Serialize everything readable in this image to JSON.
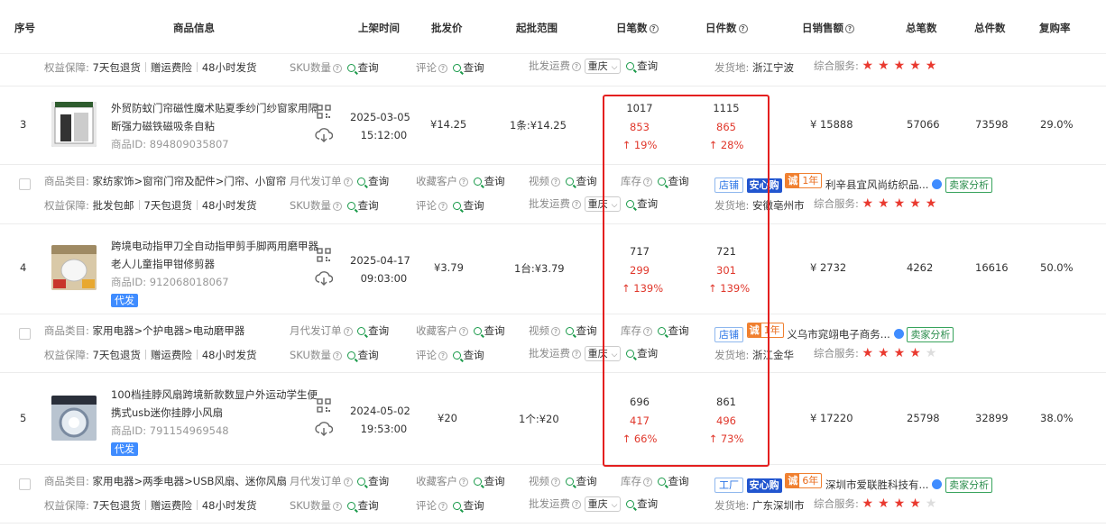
{
  "header": {
    "cols": [
      "序号",
      "商品信息",
      "上架时间",
      "批发价",
      "起批范围",
      "日笔数",
      "日件数",
      "日销售额",
      "总笔数",
      "总件数",
      "复购率"
    ]
  },
  "top_partial": {
    "guarantee_label": "权益保障:",
    "guarantee_tags": [
      "7天包退货",
      "赠运费险",
      "48小时发货"
    ],
    "sku_label": "SKU数量",
    "sku_link": "查询",
    "review_label": "评论",
    "review_link": "查询",
    "freight_label": "批发运费",
    "freight_select": "重庆",
    "freight_link": "查询",
    "ship_label": "发货地:",
    "ship_value": "浙江宁波",
    "service_label": "综合服务:",
    "stars": 5
  },
  "rows": [
    {
      "index": "3",
      "title_line1": "外贸防蚊门帘磁性魔术贴夏季纱门纱窗家用隔",
      "title_line2": "断强力磁铁磁吸条自粘",
      "product_id_label": "商品ID:",
      "product_id": "894809035807",
      "daifa": "",
      "listed_date": "2025-03-05",
      "listed_time": "15:12:00",
      "price": "¥14.25",
      "moq": "1条:¥14.25",
      "daily_orders": "1017",
      "daily_orders_prev": "853",
      "daily_orders_change": "↑ 19%",
      "daily_pieces": "1115",
      "daily_pieces_prev": "865",
      "daily_pieces_change": "↑ 28%",
      "daily_sales": "¥ 15888",
      "total_orders": "57066",
      "total_pieces": "73598",
      "repurchase": "29.0%",
      "category_label": "商品类目:",
      "category": "家纺家饰>窗帘门帘及配件>门帘、小窗帘",
      "monthly_label": "月代发订单",
      "monthly_link": "查询",
      "collect_label": "收藏客户",
      "collect_link": "查询",
      "video_label": "视频",
      "video_link": "查询",
      "stock_label": "库存",
      "stock_link": "查询",
      "shop_type": "店铺",
      "trust_badge": "安心购",
      "year_badge": "1年",
      "shop_name": "利辛县宜风尚纺织品...",
      "analysis": "卖家分析",
      "guarantee_label": "权益保障:",
      "guarantee_tags": [
        "批发包邮",
        "7天包退货",
        "48小时发货"
      ],
      "sku_label": "SKU数量",
      "sku_link": "查询",
      "review_label": "评论",
      "review_link": "查询",
      "freight_label": "批发运费",
      "freight_select": "重庆",
      "freight_link": "查询",
      "ship_label": "发货地:",
      "ship_value": "安徽亳州市",
      "service_label": "综合服务:",
      "stars": 5,
      "thumb_color": "#6d7a86"
    },
    {
      "index": "4",
      "title_line1": "跨境电动指甲刀全自动指甲剪手脚两用磨甲器",
      "title_line2": "老人儿童指甲钳修剪器",
      "product_id_label": "商品ID:",
      "product_id": "912068018067",
      "daifa": "代发",
      "listed_date": "2025-04-17",
      "listed_time": "09:03:00",
      "price": "¥3.79",
      "moq": "1台:¥3.79",
      "daily_orders": "717",
      "daily_orders_prev": "299",
      "daily_orders_change": "↑ 139%",
      "daily_pieces": "721",
      "daily_pieces_prev": "301",
      "daily_pieces_change": "↑ 139%",
      "daily_sales": "¥ 2732",
      "total_orders": "4262",
      "total_pieces": "16616",
      "repurchase": "50.0%",
      "category_label": "商品类目:",
      "category": "家用电器>个护电器>电动磨甲器",
      "monthly_label": "月代发订单",
      "monthly_link": "查询",
      "collect_label": "收藏客户",
      "collect_link": "查询",
      "video_label": "视频",
      "video_link": "查询",
      "stock_label": "库存",
      "stock_link": "查询",
      "shop_type": "店铺",
      "trust_badge": "",
      "year_badge": "1年",
      "shop_name": "义乌市窕翊电子商务...",
      "analysis": "卖家分析",
      "guarantee_label": "权益保障:",
      "guarantee_tags": [
        "7天包退货",
        "赠运费险",
        "48小时发货"
      ],
      "sku_label": "SKU数量",
      "sku_link": "查询",
      "review_label": "评论",
      "review_link": "查询",
      "freight_label": "批发运费",
      "freight_select": "重庆",
      "freight_link": "查询",
      "ship_label": "发货地:",
      "ship_value": "浙江金华",
      "service_label": "综合服务:",
      "stars": 4,
      "thumb_color": "#c9b89b"
    },
    {
      "index": "5",
      "title_line1": "100档挂脖风扇跨境新款数显户外运动学生便",
      "title_line2": "携式usb迷你挂脖小风扇",
      "product_id_label": "商品ID:",
      "product_id": "791154969548",
      "daifa": "代发",
      "listed_date": "2024-05-02",
      "listed_time": "19:53:00",
      "price": "¥20",
      "moq": "1个:¥20",
      "daily_orders": "696",
      "daily_orders_prev": "417",
      "daily_orders_change": "↑ 66%",
      "daily_pieces": "861",
      "daily_pieces_prev": "496",
      "daily_pieces_change": "↑ 73%",
      "daily_sales": "¥ 17220",
      "total_orders": "25798",
      "total_pieces": "32899",
      "repurchase": "38.0%",
      "category_label": "商品类目:",
      "category": "家用电器>两季电器>USB风扇、迷你风扇",
      "monthly_label": "月代发订单",
      "monthly_link": "查询",
      "collect_label": "收藏客户",
      "collect_link": "查询",
      "video_label": "视频",
      "video_link": "查询",
      "stock_label": "库存",
      "stock_link": "查询",
      "shop_type": "工厂",
      "trust_badge": "安心购",
      "year_badge": "6年",
      "shop_name": "深圳市爱联胜科技有...",
      "analysis": "卖家分析",
      "guarantee_label": "权益保障:",
      "guarantee_tags": [
        "7天包退货",
        "赠运费险",
        "48小时发货"
      ],
      "sku_label": "SKU数量",
      "sku_link": "查询",
      "review_label": "评论",
      "review_link": "查询",
      "freight_label": "批发运费",
      "freight_select": "重庆",
      "freight_link": "查询",
      "ship_label": "发货地:",
      "ship_value": "广东深圳市",
      "service_label": "综合服务:",
      "stars": 4,
      "thumb_color": "#a8b6c6"
    }
  ],
  "colors": {
    "accent_red": "#e0372b",
    "highlight_box": "#e41f1f",
    "link_green": "#1a9a4a",
    "badge_blue": "#2155cf"
  }
}
